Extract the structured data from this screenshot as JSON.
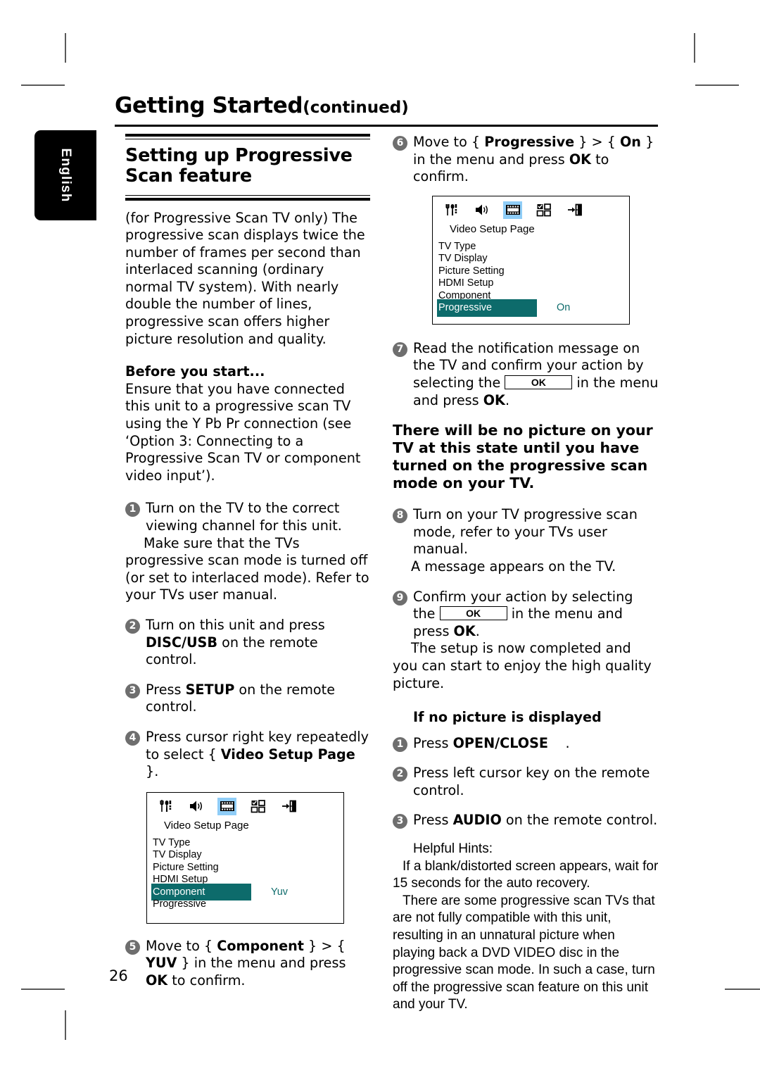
{
  "page": {
    "number": "26",
    "language_tab": "English",
    "chapter_title": "Getting Started",
    "chapter_title_suffix": "(continued)"
  },
  "left_column": {
    "section_heading": "Setting up Progressive Scan feature",
    "intro_paragraph": "(for Progressive Scan TV only) The progressive scan displays twice the number of frames per second than interlaced scanning (ordinary normal TV system). With nearly double the number of lines, progressive scan offers higher picture resolution and quality.",
    "before_you_start_heading": "Before you start...",
    "before_you_start_body": "Ensure that you have connected this unit to a progressive scan TV using the Y Pb Pr connection (see ‘Option 3: Connecting to a Progressive Scan TV or component video input’).",
    "steps": [
      {
        "num": "1",
        "text": "Turn on the TV to the correct viewing channel for this unit.",
        "note": "Make sure that the TVs progressive scan mode is turned off (or set to interlaced mode). Refer to your TVs user manual."
      },
      {
        "num": "2",
        "text_pre": "Turn on this unit and press ",
        "key": "DISC/USB",
        "text_post": " on the remote control."
      },
      {
        "num": "3",
        "text_pre": "Press ",
        "key": "SETUP",
        "text_post": " on the remote control."
      },
      {
        "num": "4",
        "text_pre": "Press cursor right key repeatedly to select { ",
        "key": "Video Setup Page",
        "text_post": " }."
      },
      {
        "num": "5",
        "text_pre": "Move to { ",
        "key": "Component",
        "text_mid": " } > { ",
        "key2": "YUV",
        "text_mid2": " } in the menu and press ",
        "key3": "OK",
        "text_post": " to confirm."
      }
    ],
    "osd": {
      "page_title": "Video Setup Page",
      "icons": [
        "utensils-icon",
        "speaker-icon",
        "film-strip-icon",
        "grid-preference-icon",
        "exit-door-icon"
      ],
      "selected_icon_index": 2,
      "rows": [
        {
          "label": "TV Type",
          "value": ""
        },
        {
          "label": "TV Display",
          "value": ""
        },
        {
          "label": "Picture Setting",
          "value": ""
        },
        {
          "label": "HDMI Setup",
          "value": ""
        },
        {
          "label": "Component",
          "value": "Yuv"
        },
        {
          "label": "Progressive",
          "value": ""
        }
      ],
      "active_row_index": 4,
      "highlight_color": "#0d6b6b",
      "selected_icon_color": "#8fcdf7"
    }
  },
  "right_column": {
    "steps": [
      {
        "num": "6",
        "text_pre": "Move to { ",
        "key": "Progressive",
        "text_mid": " } > { ",
        "key2": "On",
        "text_mid2": " } in the menu and press ",
        "key3": "OK",
        "text_post": " to confirm."
      },
      {
        "num": "7",
        "text_pre": "Read the notification message on the TV and confirm your action by selecting the ",
        "ok_glyph": "OK",
        "text_mid": " in the menu and press ",
        "key": "OK",
        "text_post": "."
      },
      {
        "num": "8",
        "text": "Turn on your TV progressive scan mode, refer to your TVs user manual.",
        "note": "A message appears on the TV."
      },
      {
        "num": "9",
        "text_pre": "Confirm your action by selecting the ",
        "ok_glyph": "OK",
        "text_mid": " in the menu and press ",
        "key": "OK",
        "text_post": ".",
        "note": "The setup is now completed and you can start to enjoy the high quality picture."
      }
    ],
    "warning": "There will be no picture on your TV at this state until you have turned on the progressive scan mode on your TV.",
    "no_picture_heading": "If no picture is displayed",
    "no_picture_steps": [
      {
        "num": "1",
        "text_pre": "Press ",
        "key": "OPEN/CLOSE",
        "text_post": " ."
      },
      {
        "num": "2",
        "text_pre": "Press left cursor key on the remote control.",
        "key": "",
        "text_post": ""
      },
      {
        "num": "3",
        "text_pre": "Press ",
        "key": "AUDIO",
        "text_post": " on the remote control."
      }
    ],
    "hints_heading": "Helpful Hints:",
    "hints": [
      "If a blank/distorted screen appears, wait for 15 seconds for the auto recovery.",
      "There are some progressive scan TVs that are not fully compatible with this unit, resulting in an unnatural picture when playing back a DVD VIDEO disc in the progressive scan mode. In such a case, turn off the progressive scan feature on this unit and your TV."
    ],
    "osd": {
      "page_title": "Video Setup Page",
      "icons": [
        "utensils-icon",
        "speaker-icon",
        "film-strip-icon",
        "grid-preference-icon",
        "exit-door-icon"
      ],
      "selected_icon_index": 2,
      "rows": [
        {
          "label": "TV Type",
          "value": ""
        },
        {
          "label": "TV Display",
          "value": ""
        },
        {
          "label": "Picture Setting",
          "value": ""
        },
        {
          "label": "HDMI Setup",
          "value": ""
        },
        {
          "label": "Component",
          "value": ""
        },
        {
          "label": "Progressive",
          "value": "On"
        }
      ],
      "active_row_index": 5,
      "highlight_color": "#0d6b6b",
      "selected_icon_color": "#8fcdf7"
    }
  }
}
